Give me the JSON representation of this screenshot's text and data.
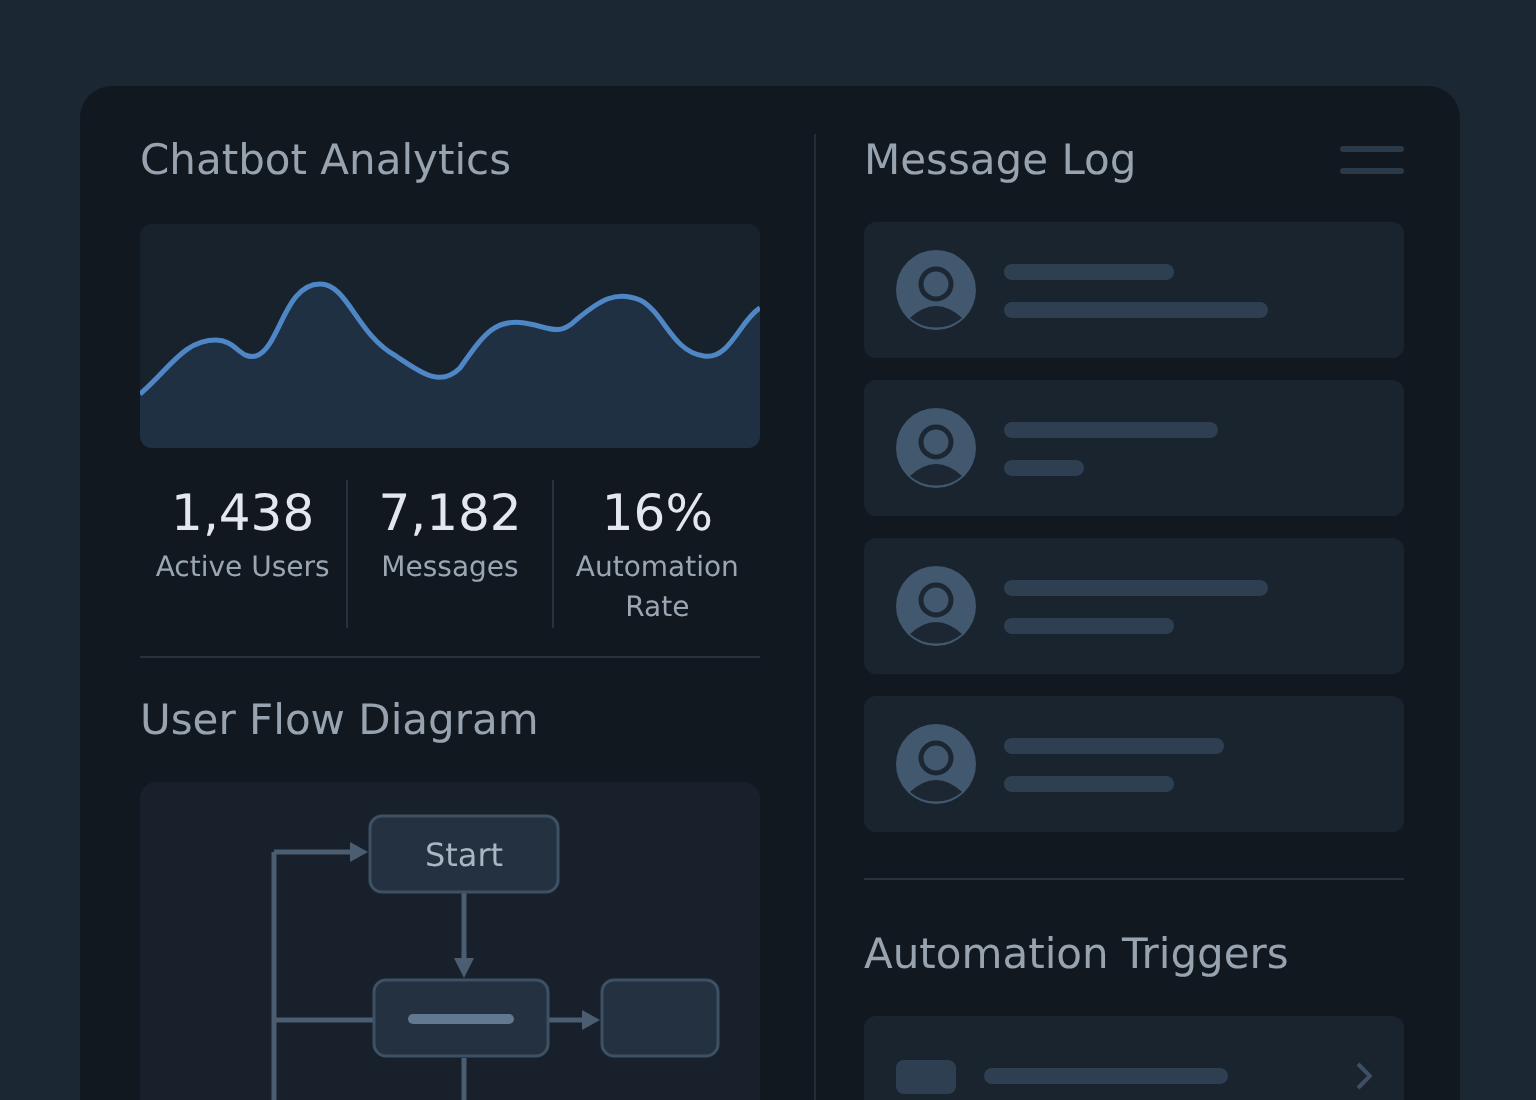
{
  "analytics": {
    "title": "Chatbot Analytics",
    "stats": [
      {
        "value": "1,438",
        "label": "Active Users"
      },
      {
        "value": "7,182",
        "label": "Messages"
      },
      {
        "value": "16%",
        "label": "Automation Rate"
      }
    ]
  },
  "flow": {
    "title": "User Flow Diagram",
    "nodes": [
      {
        "kind": "labeled",
        "label": "Start"
      },
      {
        "kind": "placeholder"
      },
      {
        "kind": "empty"
      }
    ]
  },
  "message_log": {
    "title": "Message Log",
    "items": [
      {
        "kind": "message"
      },
      {
        "kind": "message"
      },
      {
        "kind": "message"
      },
      {
        "kind": "message"
      }
    ]
  },
  "triggers": {
    "title": "Automation Triggers",
    "items": [
      {
        "kind": "trigger"
      }
    ]
  }
}
